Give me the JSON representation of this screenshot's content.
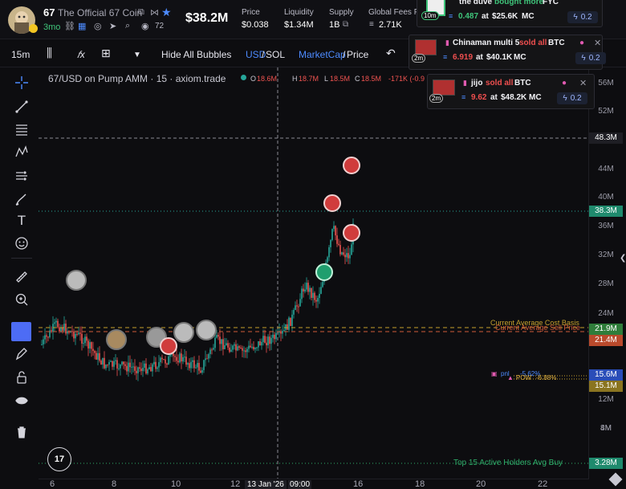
{
  "token": {
    "symbol": "67",
    "name": "The Official 67 Coin",
    "age": "3mo",
    "views": "72",
    "market_cap": "$38.2M"
  },
  "stats": [
    {
      "label": "Price",
      "value": "$0.038"
    },
    {
      "label": "Liquidity",
      "value": "$1.34M"
    },
    {
      "label": "Supply",
      "value": "1B"
    },
    {
      "label": "Global Fees P",
      "value": "2.71K"
    }
  ],
  "toolbar": {
    "interval": "15m",
    "hide_bubbles": "Hide All Bubbles",
    "usd": "USD",
    "sol": "SOL",
    "marketcap": "MarketCap",
    "price": "Price",
    "slash": "/"
  },
  "chart_header": {
    "title": "67/USD on Pump AMM · 15 · axiom.trade",
    "o_label": "O",
    "o_value": "18.6M",
    "h_label": "H",
    "h_value": "18.7M",
    "l_label": "L",
    "l_value": "18.5M",
    "c_label": "C",
    "c_value": "18.5M",
    "change": "-171K (-0.9"
  },
  "colors": {
    "background": "#0d0d10",
    "up": "#26a69a",
    "down": "#ef5350",
    "buy_text": "#3fc47a",
    "sell_text": "#ef4f4f",
    "accent": "#4d8bff",
    "cost_basis_line": "#c5a02d",
    "top_holders_line": "#2fae6a"
  },
  "price_scale": {
    "ticks": [
      "56M",
      "52M",
      "44M",
      "40M",
      "36M",
      "32M",
      "28M",
      "24M",
      "12M",
      "8M",
      "4M"
    ],
    "tags": [
      {
        "label": "48.3M",
        "kind": "crosshair"
      },
      {
        "label": "38.3M",
        "kind": "last"
      },
      {
        "label": "21.9M",
        "kind": "cost-basis"
      },
      {
        "label": "21.4M",
        "kind": "sell-avg"
      },
      {
        "label": "15.6M",
        "kind": "pnl"
      },
      {
        "label": "15.1M",
        "kind": "pow"
      },
      {
        "label": "3.28M",
        "kind": "top-holders"
      }
    ]
  },
  "time_scale": {
    "ticks": [
      "6",
      "8",
      "10",
      "12",
      "16",
      "18",
      "20",
      "22"
    ],
    "crosshair_date": "13 Jan '26",
    "crosshair_time": "09:00"
  },
  "overlays": {
    "cost_basis": "Current Average Cost Basis",
    "sell_avg": "Current Average Sell Price",
    "pnl_label": "pnl",
    "pnl_value": "-5.62%",
    "pow_label": "POW",
    "pow_value": "-6.88%",
    "top_holders": "Top 15 Active Holders Avg Buy"
  },
  "notifications": [
    {
      "age": "10m",
      "trader": "the duve",
      "action": "bought more",
      "ticker": "FYC",
      "amount": "0.487",
      "at": "at",
      "mc": "$25.6K",
      "mc_label": "MC",
      "bolt": "0.2"
    },
    {
      "age": "2m",
      "trader": "Chinaman multi 5",
      "action": "sold all",
      "ticker": "BTC",
      "amount": "6.919",
      "at": "at",
      "mc": "$40.1K",
      "mc_label": "MC",
      "bolt": "0.2"
    },
    {
      "age": "2m",
      "trader": "jijo",
      "action": "sold all",
      "ticker": "BTC",
      "amount": "9.62",
      "at": "at",
      "mc": "$48.2K",
      "mc_label": "MC",
      "bolt": "0.2"
    }
  ],
  "icons": {
    "copy": "copy-icon",
    "star": "star-icon",
    "link": "link-icon",
    "search": "search-icon",
    "views": "eye-icon",
    "crosshair": "crosshair-icon",
    "trend": "trend-line-icon",
    "text": "text-icon",
    "trash": "trash-icon"
  }
}
